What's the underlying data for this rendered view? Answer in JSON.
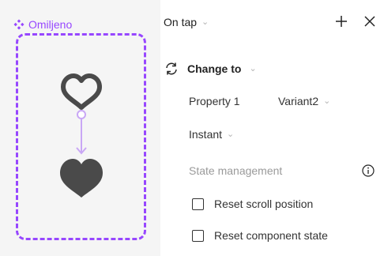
{
  "component": {
    "label": "Omiljeno",
    "icon": "component-icon",
    "accent_color": "#9747ff"
  },
  "flow": {
    "from_icon": "heart-outline-icon",
    "to_icon": "heart-filled-icon",
    "connector_color": "#c9a7f5"
  },
  "interaction": {
    "trigger_label": "On tap",
    "add_icon": "plus-icon",
    "close_icon": "close-icon",
    "action_icon": "swap-icon",
    "action_label": "Change to",
    "property_name": "Property 1",
    "property_value": "Variant2",
    "transition_label": "Instant",
    "section_title": "State management",
    "info_icon": "info-icon",
    "checkbox_scroll_label": "Reset scroll position",
    "checkbox_component_label": "Reset component state",
    "checkbox_scroll_checked": false,
    "checkbox_component_checked": false
  }
}
